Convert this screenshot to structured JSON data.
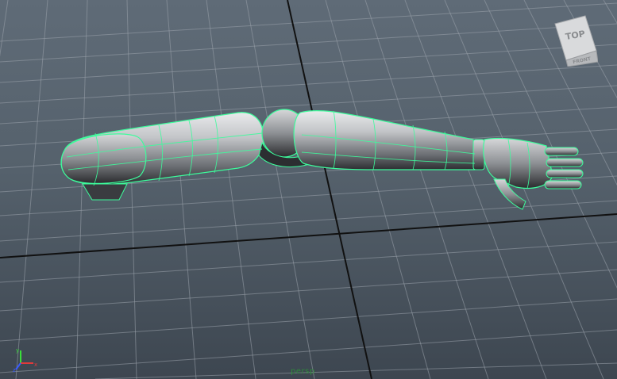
{
  "viewport": {
    "camera_label": "persp",
    "background_top": "#5f6b77",
    "background_bottom": "#3d4650",
    "grid_color": "#9aa3ab",
    "axis_line_color": "#111111",
    "wireframe_color": "#3dfc9c"
  },
  "viewcube": {
    "top_label": "TOP",
    "front_label": "FRONT"
  },
  "axis_gizmo": {
    "y_label": "y",
    "x_label": "x",
    "z_label": "z",
    "y_color": "#3adf3a",
    "x_color": "#e23a3a",
    "z_color": "#3a5cff"
  },
  "model": {
    "icon": "robotic-arm-mesh"
  }
}
